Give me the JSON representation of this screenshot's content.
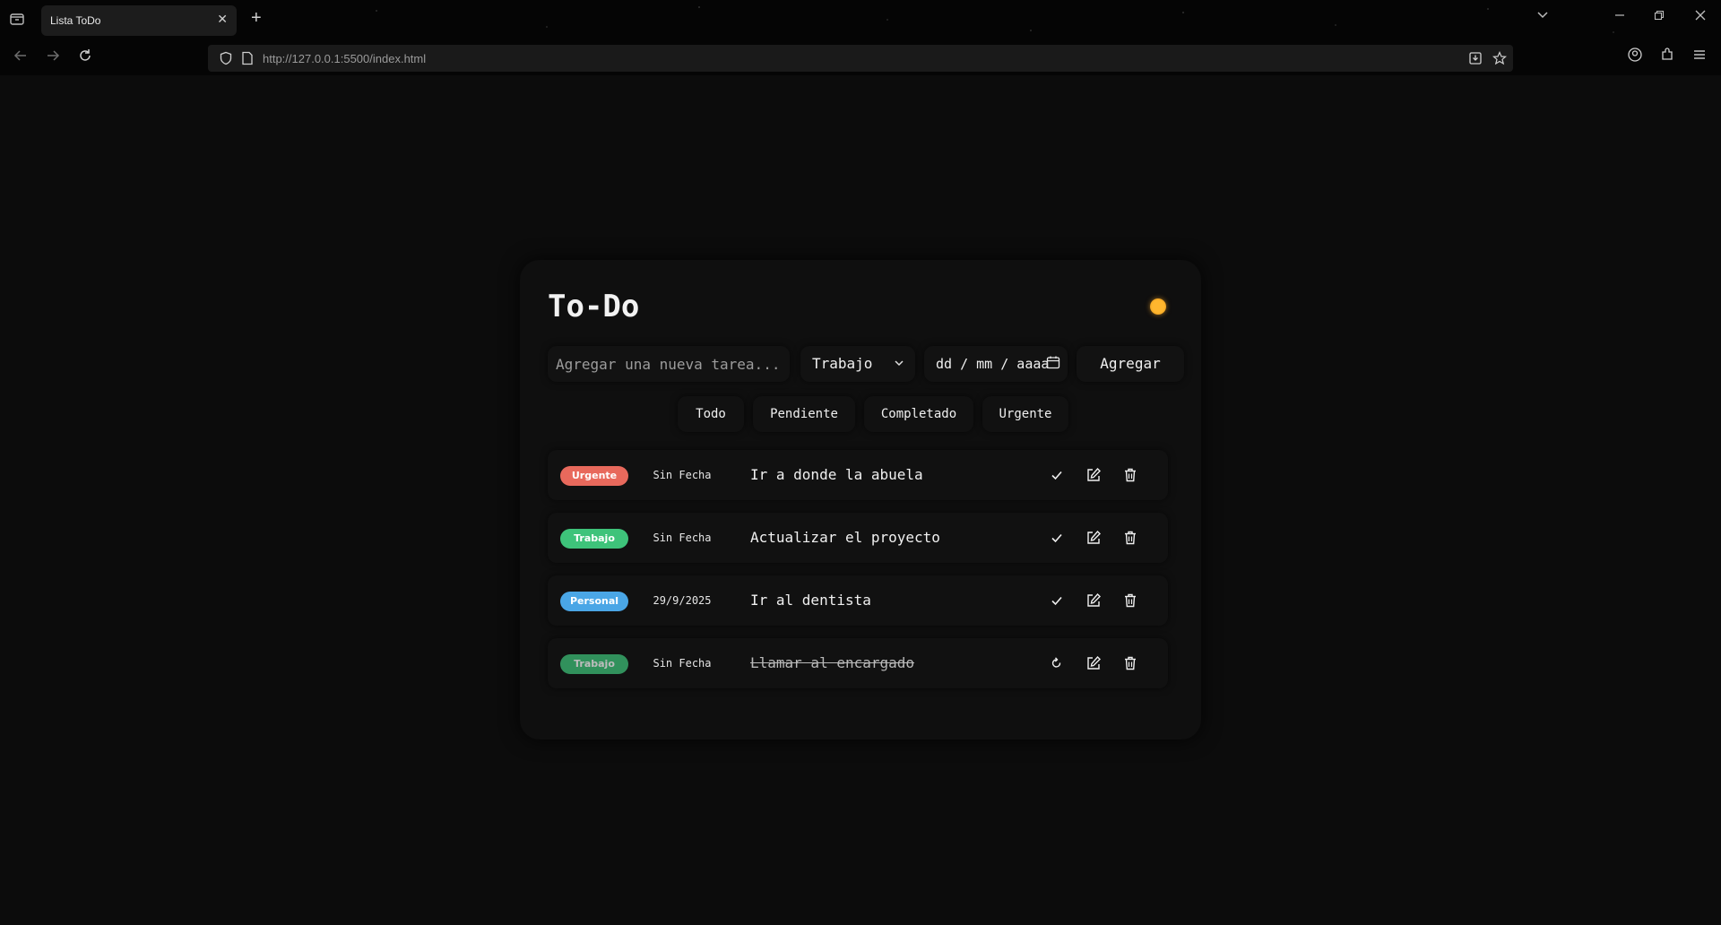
{
  "browser": {
    "tab_title": "Lista ToDo",
    "url": "http://127.0.0.1:5500/index.html"
  },
  "app": {
    "title": "To-Do",
    "theme_icon": "sun-icon",
    "form": {
      "task_placeholder": "Agregar una nueva tarea...",
      "category_selected": "Trabajo",
      "date_placeholder": "dd / mm / aaaa",
      "add_label": "Agregar"
    },
    "filters": [
      "Todo",
      "Pendiente",
      "Completado",
      "Urgente"
    ],
    "tasks": [
      {
        "category": "Urgente",
        "category_color": "#e8695c",
        "date": "Sin Fecha",
        "text": "Ir a donde la abuela",
        "done": false
      },
      {
        "category": "Trabajo",
        "category_color": "#3ec37a",
        "date": "Sin Fecha",
        "text": "Actualizar el proyecto",
        "done": false
      },
      {
        "category": "Personal",
        "category_color": "#4aa6e6",
        "date": "29/9/2025",
        "text": "Ir al dentista",
        "done": false
      },
      {
        "category": "Trabajo",
        "category_color": "#3ec37a",
        "date": "Sin Fecha",
        "text": "Llamar al encargado",
        "done": true
      }
    ]
  }
}
